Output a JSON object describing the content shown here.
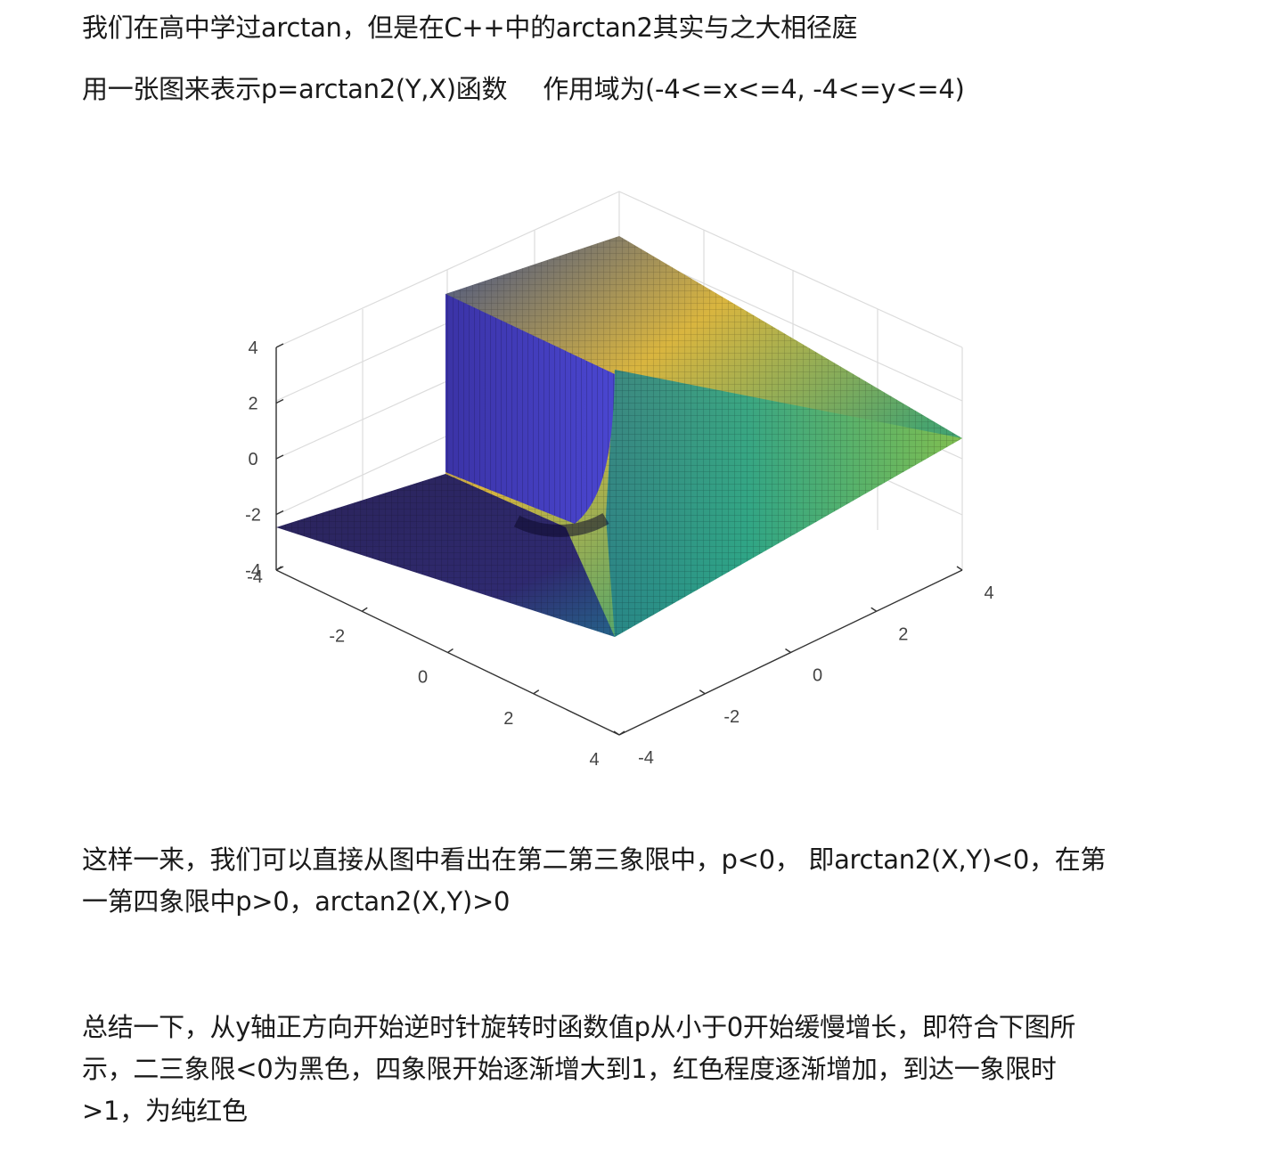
{
  "paragraphs": {
    "p1": "我们在高中学过arctan，但是在C++中的arctan2其实与之大相径庭",
    "p2_a": "用一张图来表示p=arctan2(Y,X)函数",
    "p2_b": "作用域为(-4<=x<=4, -4<=y<=4)",
    "p3_line1": "这样一来，我们可以直接从图中看出在第二第三象限中，p<0， 即arctan2(X,Y)<0，在第",
    "p3_line2": "一第四象限中p>0，arctan2(X,Y)>0",
    "p4_line1": "总结一下，从y轴正方向开始逆时针旋转时函数值p从小于0开始缓慢增长，即符合下图所",
    "p4_line2": "示，二三象限<0为黑色，四象限开始逐渐增大到1，红色程度逐渐增加，到达一象限时",
    "p4_line3": ">1，为纯红色"
  },
  "chart_data": {
    "type": "surface",
    "function": "p = arctan2(Y, X)",
    "x_range": [
      -4,
      4
    ],
    "y_range": [
      -4,
      4
    ],
    "z_range": [
      -4,
      4
    ],
    "z_ticks": [
      "4",
      "2",
      "0",
      "-2",
      "-4"
    ],
    "x_ticks": [
      "-4",
      "-2",
      "0",
      "2",
      "4"
    ],
    "y_ticks": [
      "-4",
      "-2",
      "0",
      "2",
      "4"
    ],
    "colormap": "parula",
    "colors": {
      "low": "#352a87",
      "mid": "#21a38c",
      "high": "#f9fb0e"
    },
    "grid": true
  }
}
